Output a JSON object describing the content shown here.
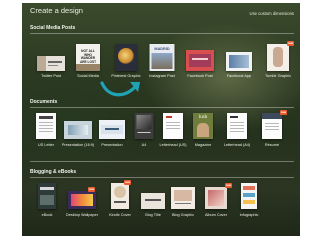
{
  "header": {
    "title": "Create a design",
    "custom_link": "Use custom dimensions"
  },
  "social": {
    "title": "Social Media Posts",
    "items": [
      {
        "label": "Twitter Post"
      },
      {
        "label": "Social Media",
        "thumb_text": "NOT ALL WHO WANDER ARE LOST"
      },
      {
        "label": "Pinterest Graphic"
      },
      {
        "label": "Instagram Post",
        "thumb_text": "MADRID"
      },
      {
        "label": "Facebook Post"
      },
      {
        "label": "Facebook App"
      },
      {
        "label": "Tumblr Graphic",
        "badge": "new"
      }
    ]
  },
  "documents": {
    "title": "Documents",
    "items": [
      {
        "label": "US Letter"
      },
      {
        "label": "Presentation (16:9)"
      },
      {
        "label": "Presentation"
      },
      {
        "label": "A4"
      },
      {
        "label": "Letterhead (US)"
      },
      {
        "label": "Magazine",
        "thumb_text": "lush"
      },
      {
        "label": "Letterhead (A4)"
      },
      {
        "label": "Résumé",
        "badge": "new"
      }
    ]
  },
  "blogging": {
    "title": "Blogging & eBooks",
    "items": [
      {
        "label": "eBook"
      },
      {
        "label": "Desktop Wallpaper",
        "badge": "new"
      },
      {
        "label": "Kindle Cover",
        "badge": "new"
      },
      {
        "label": "Blog Title"
      },
      {
        "label": "Blog Graphic"
      },
      {
        "label": "Album Cover",
        "badge": "new"
      },
      {
        "label": "Infographic"
      }
    ]
  },
  "colors": {
    "accent_arrow": "#1fa3b5",
    "badge": "#e85b2e"
  }
}
